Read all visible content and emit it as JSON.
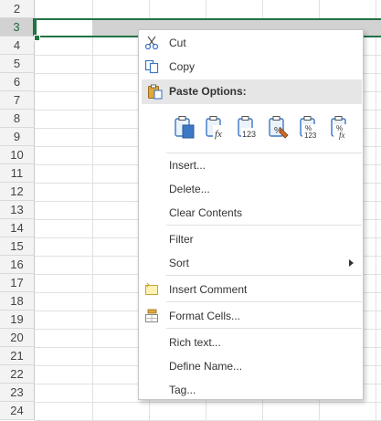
{
  "sheet": {
    "rows": [
      "2",
      "3",
      "4",
      "5",
      "6",
      "7",
      "8",
      "9",
      "10",
      "11",
      "12",
      "13",
      "14",
      "15",
      "16",
      "17",
      "18",
      "19",
      "20",
      "21",
      "22",
      "23",
      "24"
    ],
    "selected_row": "3"
  },
  "menu": {
    "cut": "Cut",
    "copy": "Copy",
    "paste_options": "Paste Options:",
    "paste_icons": [
      "paste-icon",
      "paste-formulas-icon",
      "paste-values-icon",
      "paste-formatting-icon",
      "paste-values-number-format-icon",
      "paste-formulas-number-format-icon"
    ],
    "paste_icon_texts": [
      "",
      "fx",
      "123",
      "%",
      "%123",
      "%fx"
    ],
    "insert": "Insert...",
    "delete": "Delete...",
    "clear_contents": "Clear Contents",
    "filter": "Filter",
    "sort": "Sort",
    "insert_comment": "Insert Comment",
    "format_cells": "Format Cells...",
    "rich_text": "Rich text...",
    "define_name": "Define Name...",
    "tag": "Tag..."
  },
  "colors": {
    "accent_green": "#217346",
    "clipboard_blue": "#3c78c4",
    "clipboard_yellow": "#e0a83a"
  }
}
